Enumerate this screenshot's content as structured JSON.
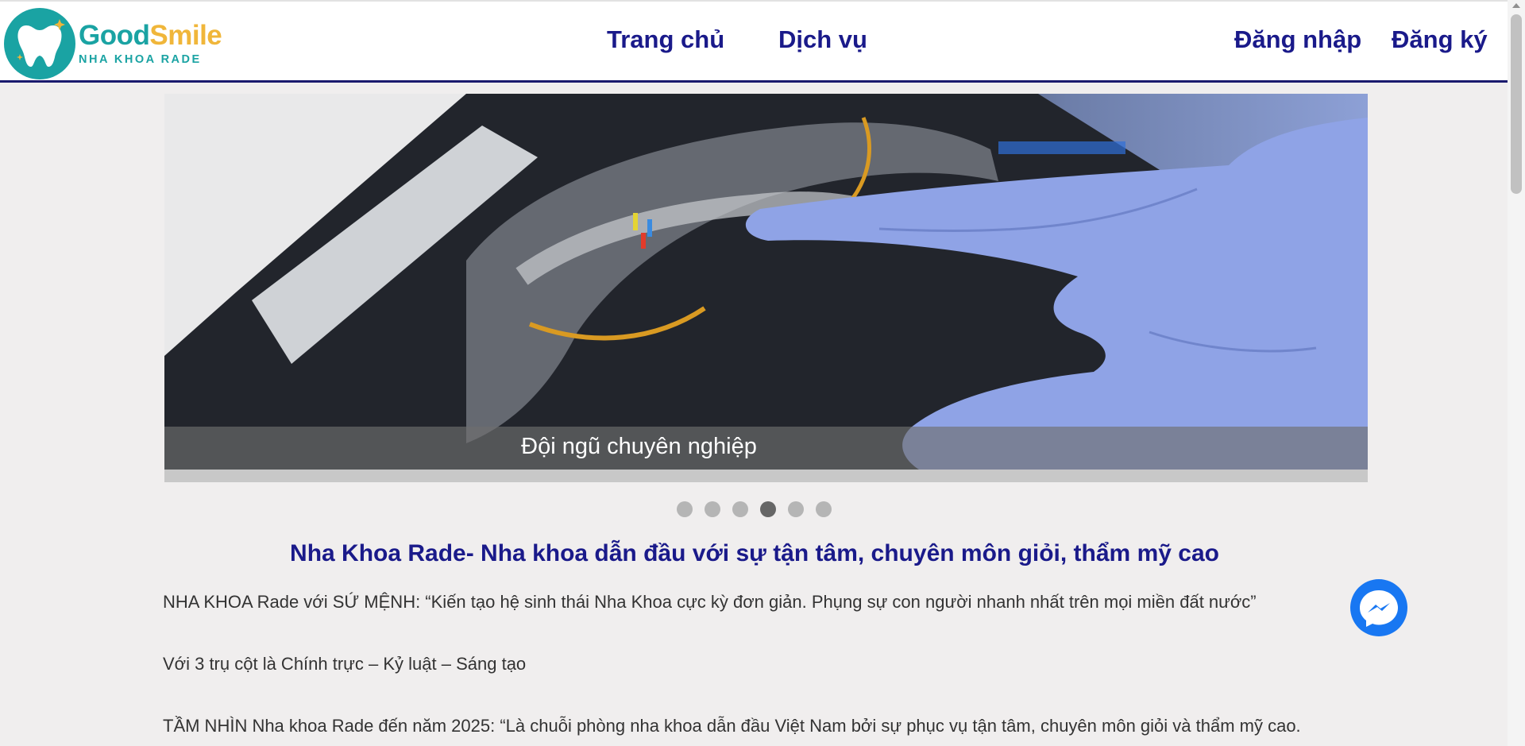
{
  "brand": {
    "name_part1": "Good",
    "name_part2": "Smile",
    "subtitle": "NHA KHOA RADE",
    "colors": {
      "teal": "#1aa3a3",
      "gold": "#f0b63a",
      "navy": "#1a1a8a"
    }
  },
  "nav": {
    "home": "Trang chủ",
    "services": "Dịch vụ",
    "login": "Đăng nhập",
    "register": "Đăng ký"
  },
  "slider": {
    "caption": "Đội ngũ chuyên nghiệp",
    "dots": [
      {
        "active": false
      },
      {
        "active": false
      },
      {
        "active": false
      },
      {
        "active": true
      },
      {
        "active": false
      },
      {
        "active": false
      }
    ]
  },
  "content": {
    "heading": "Nha Khoa Rade- Nha khoa dẫn đầu với sự tận tâm, chuyên môn giỏi, thẩm mỹ cao",
    "paragraphs": [
      "NHA KHOA Rade với SỨ MỆNH: “Kiến tạo hệ sinh thái Nha Khoa cực kỳ đơn giản. Phụng sự con người nhanh nhất trên mọi miền đất nước”",
      "Với 3 trụ cột là Chính trực – Kỷ luật – Sáng tạo",
      "TẦM NHÌN Nha khoa Rade đến năm 2025: “Là chuỗi phòng nha khoa dẫn đầu Việt Nam bởi sự phục vụ tận tâm, chuyên môn giỏi và thẩm mỹ cao."
    ]
  },
  "icons": {
    "logo": "tooth-logo-icon",
    "chat": "messenger-icon"
  }
}
